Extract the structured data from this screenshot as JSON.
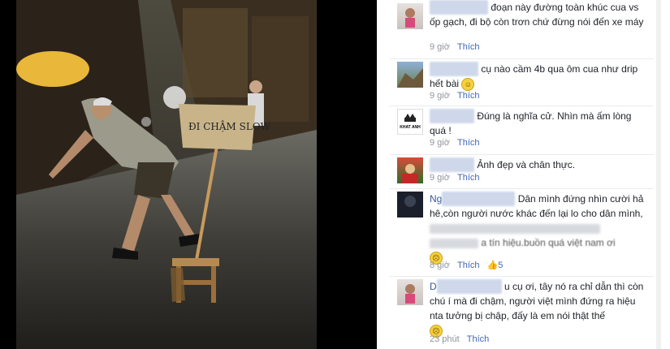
{
  "photo": {
    "sign_text": "ĐI CHẬM SLOW"
  },
  "comments": [
    {
      "text": "đoạn này đường toàn khúc cua vs ốp gạch, đi bộ còn trơn chứ đừng nói đến xe máy",
      "time": "9 giờ",
      "like": "Thích"
    },
    {
      "text": "cụ nào cầm 4b qua ôm cua như drip hết bài",
      "time": "9 giờ",
      "like": "Thích"
    },
    {
      "text": "Đúng là nghĩa cử. Nhìn mà ấm lòng quá !",
      "time": "9 giờ",
      "like": "Thích"
    },
    {
      "text": "Ảnh đẹp và chân thực.",
      "time": "9 giờ",
      "like": "Thích"
    },
    {
      "text_prefix": "Ng",
      "text": "Dân mình đứng nhìn cười hả hê,còn người nước khác đến lại lo cho dân mình,",
      "tail": "a tín hiệu.buồn quá việt nam ơi",
      "time": "8 giờ",
      "like": "Thích",
      "likes": "5"
    },
    {
      "text_prefix": "D",
      "text": "u cụ ơi, tây nó ra chỉ dẫn thì còn chú í mà đi chậm, người việt mình đứng ra hiệu nta tưởng bị chập, đấy là em nói thật thế",
      "time": "23 phút",
      "like": "Thích"
    }
  ],
  "avatar_text": "KHAT ANH"
}
